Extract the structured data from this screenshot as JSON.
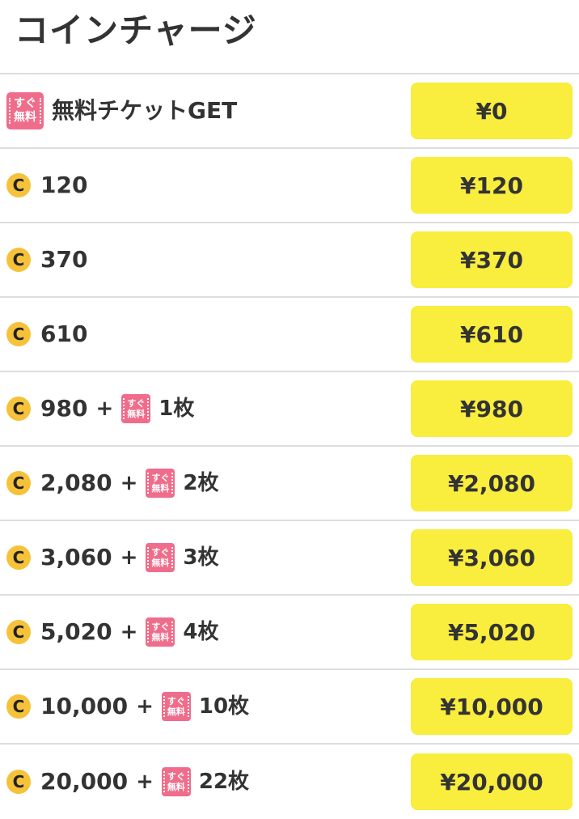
{
  "header": {
    "title": "コインチャージ"
  },
  "ticket_badge": {
    "line1": "すぐ",
    "line2": "無料"
  },
  "coin_icon": {
    "letter": "C",
    "color": "#f6c23a"
  },
  "colors": {
    "price_button": "#f9ed3d",
    "ticket": "#ef6d8b",
    "divider": "#dddddd",
    "text": "#333333"
  },
  "rows": [
    {
      "type": "free",
      "label": "無料チケットGET",
      "price": "¥0"
    },
    {
      "type": "coin",
      "coins": "120",
      "price": "¥120"
    },
    {
      "type": "coin",
      "coins": "370",
      "price": "¥370"
    },
    {
      "type": "coin",
      "coins": "610",
      "price": "¥610"
    },
    {
      "type": "bonus",
      "coins": "980",
      "plus": "+",
      "tickets": "1枚",
      "price": "¥980"
    },
    {
      "type": "bonus",
      "coins": "2,080",
      "plus": "+",
      "tickets": "2枚",
      "price": "¥2,080"
    },
    {
      "type": "bonus",
      "coins": "3,060",
      "plus": "+",
      "tickets": "3枚",
      "price": "¥3,060"
    },
    {
      "type": "bonus",
      "coins": "5,020",
      "plus": "+",
      "tickets": "4枚",
      "price": "¥5,020"
    },
    {
      "type": "bonus",
      "coins": "10,000",
      "plus": "+",
      "tickets": "10枚",
      "price": "¥10,000"
    },
    {
      "type": "bonus",
      "coins": "20,000",
      "plus": "+",
      "tickets": "22枚",
      "price": "¥20,000"
    }
  ]
}
